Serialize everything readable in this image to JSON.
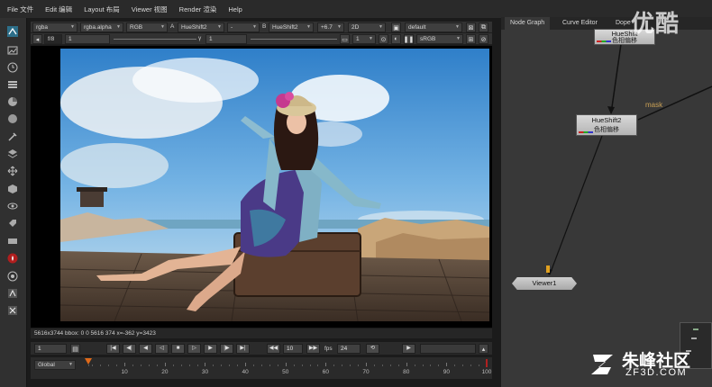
{
  "menu": [
    {
      "label": "File 文件"
    },
    {
      "label": "Edit 编辑"
    },
    {
      "label": "Layout 布局"
    },
    {
      "label": "Viewer 视图"
    },
    {
      "label": "Render 渲染"
    },
    {
      "label": "Help"
    }
  ],
  "viewer_controls": {
    "row1": {
      "channels": "rgba",
      "alpha": "rgba.alpha",
      "display": "RGB",
      "input_a_label": "A",
      "input_a": "HueShift2",
      "wipe_mode": "-",
      "input_b_label": "B",
      "input_b": "HueShift2",
      "gain": "+6.7",
      "view_mode": "2D",
      "lut": "default"
    },
    "row2": {
      "frame_range": "f/8",
      "frame_value": "1",
      "gamma_label": "γ",
      "gamma_value": "1",
      "proxy": "1",
      "colorspace": "sRGB"
    }
  },
  "info_bar": {
    "text": "5616x3744 bbox: 0 0 5616 374  x=-362 y=3423"
  },
  "playback": {
    "current_frame": "1",
    "step": "10",
    "fps_label": "fps",
    "fps": "24"
  },
  "timeline": {
    "mode": "Global",
    "start": 1,
    "end": 100,
    "current": 1,
    "tick_labels": [
      "10",
      "20",
      "30",
      "40",
      "50",
      "60",
      "70",
      "80",
      "90",
      "100"
    ]
  },
  "node_graph": {
    "tabs": [
      {
        "label": "Node Graph"
      },
      {
        "label": "Curve Editor"
      },
      {
        "label": "Dope"
      }
    ],
    "nodes": [
      {
        "name": "HueShift",
        "subtitle": "色相偏移"
      },
      {
        "name": "HueShift2",
        "subtitle": "色相偏移"
      },
      {
        "name": "Viewer1"
      }
    ],
    "mask_label": "mask"
  },
  "watermark": {
    "top": "优酷",
    "bottom": "朱峰社区",
    "url": "ZF3D.COM"
  },
  "colors": {
    "accent_orange": "#e06a1a",
    "mask_color": "#c9a055",
    "panel_bg": "#383838"
  }
}
